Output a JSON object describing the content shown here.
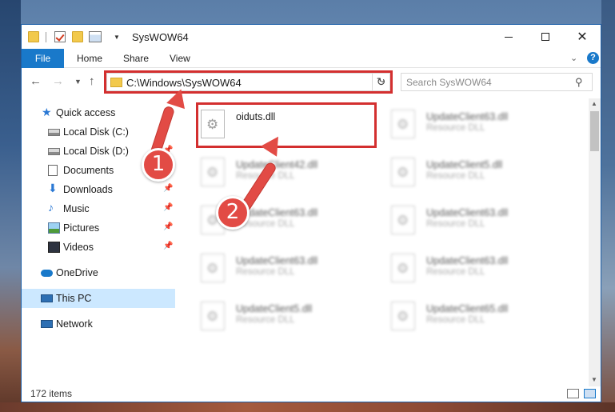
{
  "window": {
    "title": "SysWOW64"
  },
  "ribbon": {
    "tabs": [
      "File",
      "Home",
      "Share",
      "View"
    ]
  },
  "navigation": {
    "address": "C:\\Windows\\SysWOW64",
    "search_placeholder": "Search SysWOW64"
  },
  "sidebar": {
    "items": [
      {
        "label": "Quick access",
        "icon": "star-icon",
        "pinned": false
      },
      {
        "label": "Local Disk (C:)",
        "icon": "drive-icon",
        "pinned": false
      },
      {
        "label": "Local Disk (D:)",
        "icon": "drive-icon",
        "pinned": false
      },
      {
        "label": "Documents",
        "icon": "documents-icon",
        "pinned": true
      },
      {
        "label": "Downloads",
        "icon": "download-icon",
        "pinned": true
      },
      {
        "label": "Music",
        "icon": "music-icon",
        "pinned": true
      },
      {
        "label": "Pictures",
        "icon": "pictures-icon",
        "pinned": true
      },
      {
        "label": "Videos",
        "icon": "videos-icon",
        "pinned": true
      },
      {
        "label": "OneDrive",
        "icon": "cloud-icon",
        "pinned": false
      },
      {
        "label": "This PC",
        "icon": "computer-icon",
        "pinned": false,
        "selected": true
      },
      {
        "label": "Network",
        "icon": "network-icon",
        "pinned": false
      }
    ]
  },
  "files": [
    {
      "name": "oiduts.dll",
      "type": ""
    },
    {
      "name": "UpdateClient63.dll",
      "type": "Resource DLL"
    },
    {
      "name": "UpdateClient42.dll",
      "type": "Resource DLL"
    },
    {
      "name": "UpdateClient5.dll",
      "type": "Resource DLL"
    },
    {
      "name": "UpdateClient63.dll",
      "type": "Resource DLL"
    },
    {
      "name": "UpdateClient63.dll",
      "type": "Resource DLL"
    },
    {
      "name": "UpdateClient63.dll",
      "type": "Resource DLL"
    },
    {
      "name": "UpdateClient63.dll",
      "type": "Resource DLL"
    },
    {
      "name": "UpdateClient5.dll",
      "type": "Resource DLL"
    },
    {
      "name": "UpdateClient65.dll",
      "type": "Resource DLL"
    }
  ],
  "status": {
    "item_count": "172 items"
  },
  "annotations": {
    "step1": "1",
    "step2": "2"
  },
  "colors": {
    "accent": "#1979ca",
    "highlight": "#d32f2f",
    "selected_bg": "#cce8ff"
  }
}
